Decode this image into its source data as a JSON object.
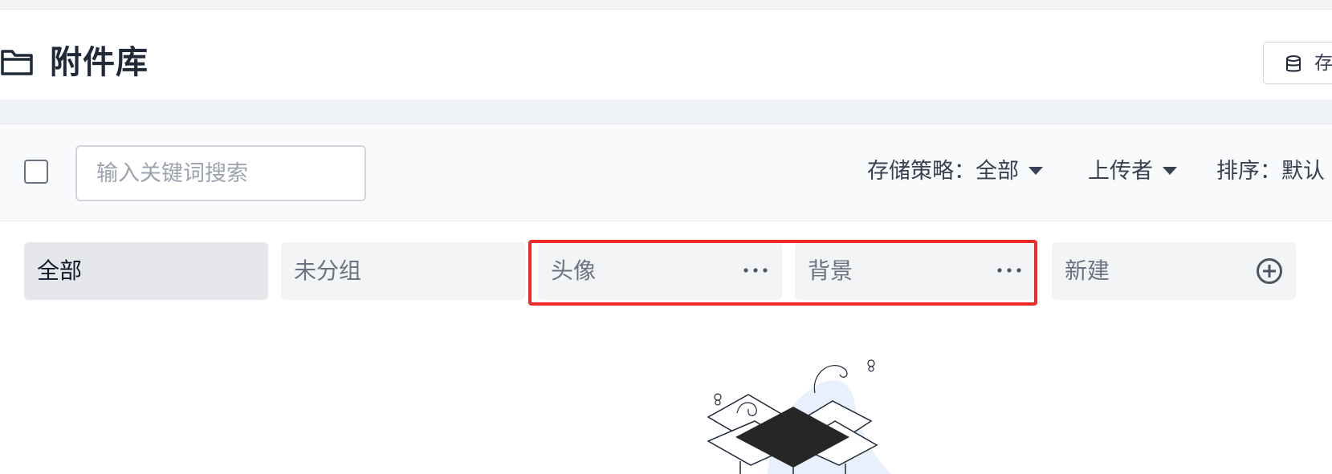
{
  "header": {
    "title": "附件库",
    "icon": "folder-icon",
    "storage_button_label": "存"
  },
  "toolbar": {
    "search_placeholder": "输入关键词搜索",
    "search_value": "",
    "storage_filter_label": "存储策略：全部",
    "uploader_filter_label": "上传者",
    "sort_filter_label": "排序：默认"
  },
  "groups": {
    "all": "全部",
    "ungrouped": "未分组",
    "avatar": "头像",
    "background": "背景",
    "new": "新建"
  },
  "colors": {
    "highlight": "#ee2a24",
    "active_tab": "#e5e7eb",
    "tab": "#f3f4f6",
    "illustration_blob": "#e8f0fd"
  }
}
